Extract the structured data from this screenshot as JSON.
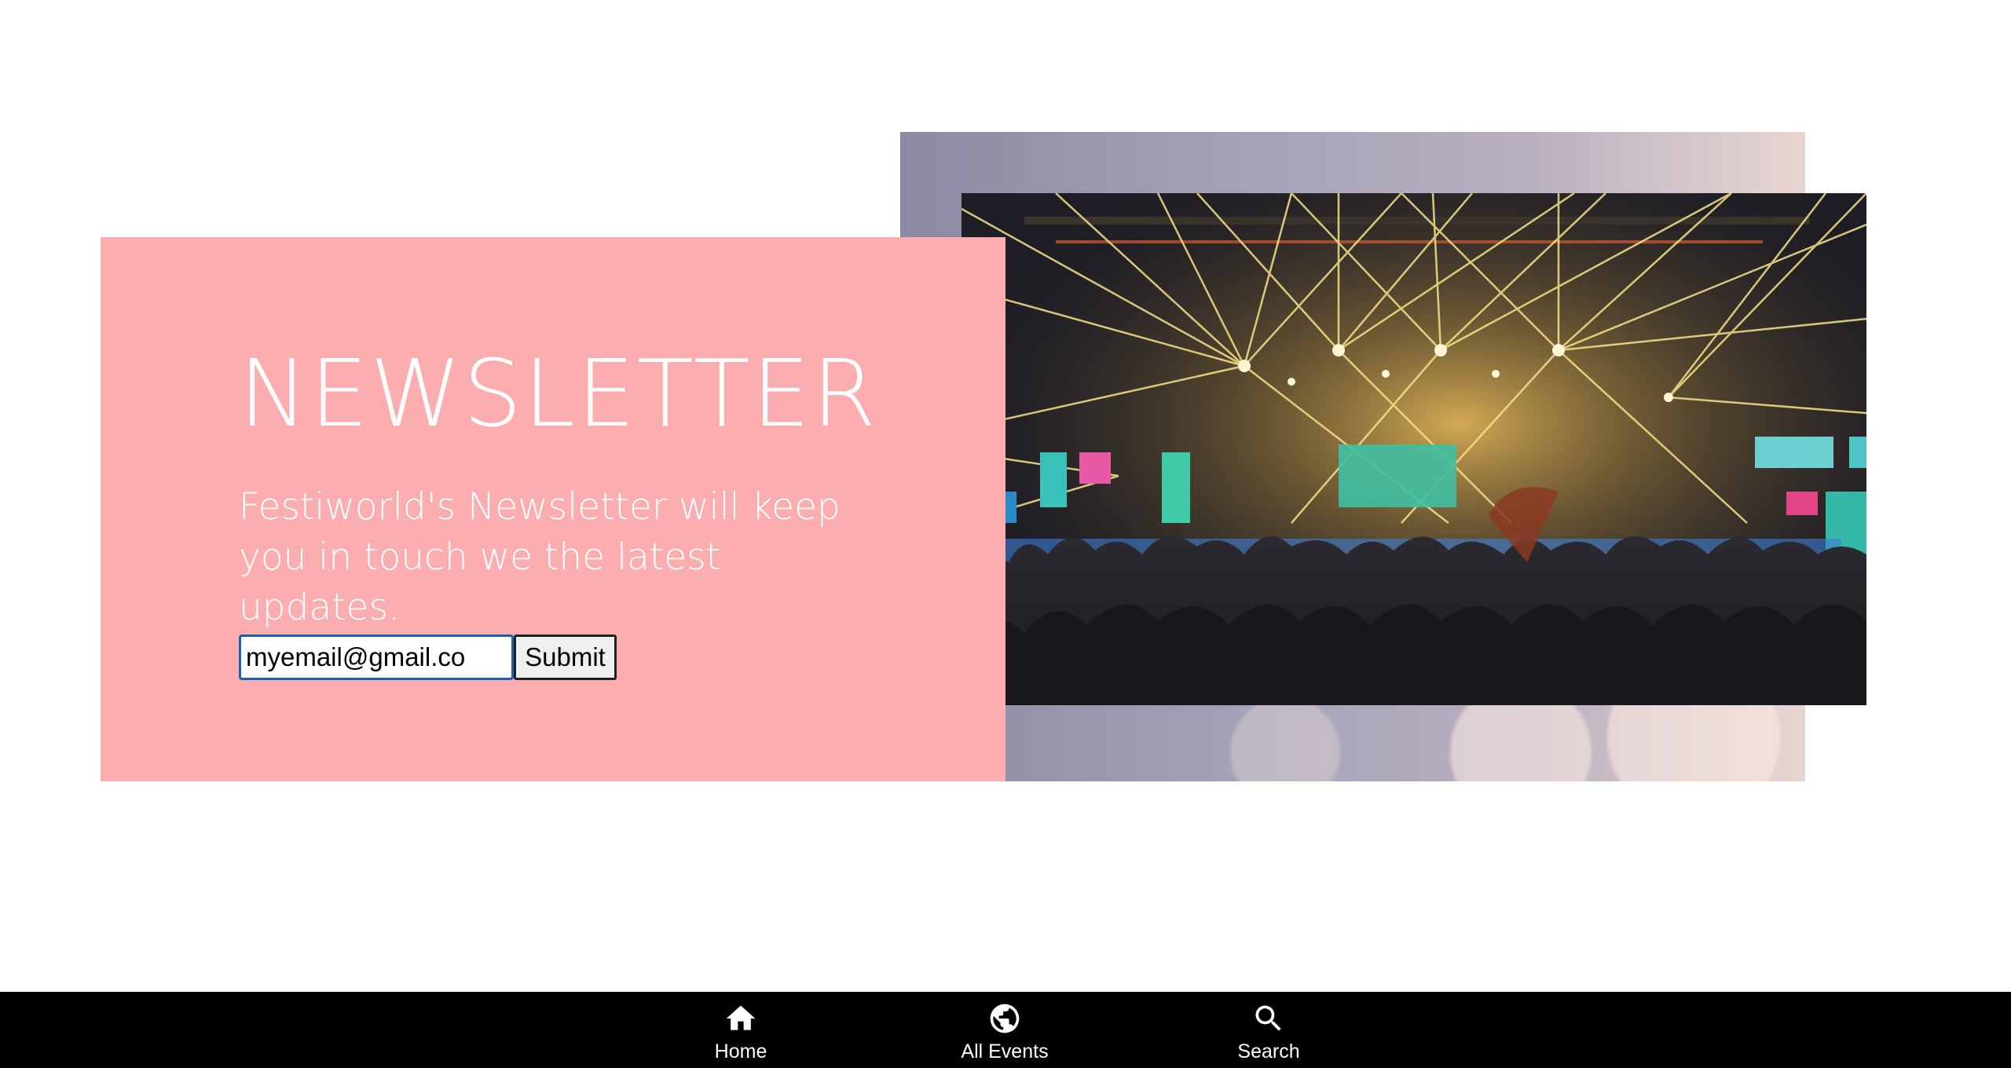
{
  "newsletter": {
    "title": "NEWSLETTER",
    "description": "Festiworld's Newsletter will keep you in touch we the latest updates.",
    "email_value": "myemail@gmail.co",
    "submit_label": "Submit",
    "card_color": "#fcadaf"
  },
  "hero_image": {
    "icon": "concert-photo"
  },
  "bottom_nav": {
    "items": [
      {
        "label": "Home",
        "icon": "home-icon"
      },
      {
        "label": "All Events",
        "icon": "globe-icon"
      },
      {
        "label": "Search",
        "icon": "search-icon"
      }
    ]
  }
}
